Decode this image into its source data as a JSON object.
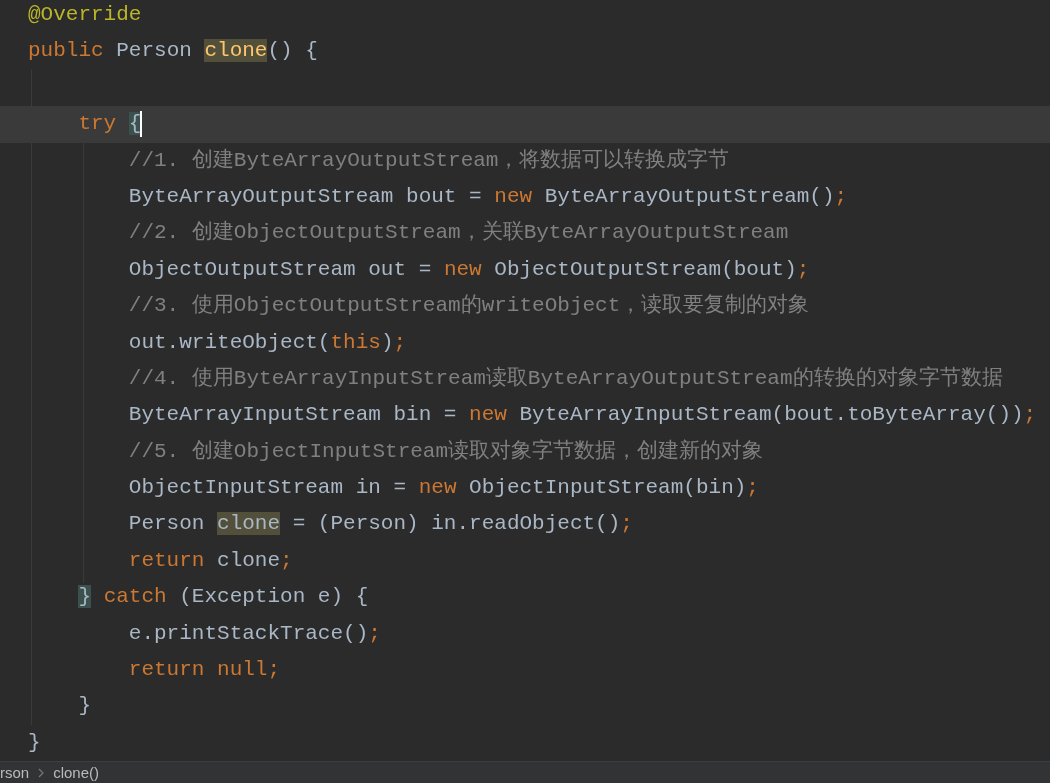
{
  "editor": {
    "lines": [
      {
        "current": false,
        "tokens": [
          {
            "kind": "annotation",
            "text": "@Override"
          }
        ]
      },
      {
        "current": false,
        "tokens": [
          {
            "kind": "keyword",
            "text": "public "
          },
          {
            "kind": "plain",
            "text": "Person "
          },
          {
            "kind": "method_usage",
            "text": "clone"
          },
          {
            "kind": "plain",
            "text": "() {"
          }
        ]
      },
      {
        "current": false
      },
      {
        "current": true,
        "caret": true,
        "tokens": [
          {
            "kind": "keyword",
            "text": "    try "
          },
          {
            "kind": "brace_match",
            "text": "{"
          }
        ]
      },
      {
        "current": false,
        "tokens": [
          {
            "kind": "comment",
            "text": "        //1. 创建ByteArrayOutputStream，将数据可以转换成字节"
          }
        ]
      },
      {
        "current": false,
        "tokens": [
          {
            "kind": "plain",
            "text": "        ByteArrayOutputStream bout = "
          },
          {
            "kind": "keyword",
            "text": "new "
          },
          {
            "kind": "plain",
            "text": "ByteArrayOutputStream()"
          },
          {
            "kind": "keyword",
            "text": ";"
          }
        ]
      },
      {
        "current": false,
        "tokens": [
          {
            "kind": "comment",
            "text": "        //2. 创建ObjectOutputStream，关联ByteArrayOutputStream"
          }
        ]
      },
      {
        "current": false,
        "tokens": [
          {
            "kind": "plain",
            "text": "        ObjectOutputStream out = "
          },
          {
            "kind": "keyword",
            "text": "new "
          },
          {
            "kind": "plain",
            "text": "ObjectOutputStream(bout)"
          },
          {
            "kind": "keyword",
            "text": ";"
          }
        ]
      },
      {
        "current": false,
        "tokens": [
          {
            "kind": "comment",
            "text": "        //3. 使用ObjectOutputStream的writeObject，读取要复制的对象"
          }
        ]
      },
      {
        "current": false,
        "tokens": [
          {
            "kind": "plain",
            "text": "        out.writeObject("
          },
          {
            "kind": "keyword",
            "text": "this"
          },
          {
            "kind": "plain",
            "text": ")"
          },
          {
            "kind": "keyword",
            "text": ";"
          }
        ]
      },
      {
        "current": false,
        "tokens": [
          {
            "kind": "comment",
            "text": "        //4. 使用ByteArrayInputStream读取ByteArrayOutputStream的转换的对象字节数据"
          }
        ]
      },
      {
        "current": false,
        "tokens": [
          {
            "kind": "plain",
            "text": "        ByteArrayInputStream bin = "
          },
          {
            "kind": "keyword",
            "text": "new "
          },
          {
            "kind": "plain",
            "text": "ByteArrayInputStream(bout.toByteArray())"
          },
          {
            "kind": "keyword",
            "text": ";"
          }
        ]
      },
      {
        "current": false,
        "tokens": [
          {
            "kind": "comment",
            "text": "        //5. 创建ObjectInputStream读取对象字节数据，创建新的对象"
          }
        ]
      },
      {
        "current": false,
        "tokens": [
          {
            "kind": "plain",
            "text": "        ObjectInputStream in = "
          },
          {
            "kind": "keyword",
            "text": "new "
          },
          {
            "kind": "plain",
            "text": "ObjectInputStream(bin)"
          },
          {
            "kind": "keyword",
            "text": ";"
          }
        ]
      },
      {
        "current": false,
        "tokens": [
          {
            "kind": "plain",
            "text": "        Person "
          },
          {
            "kind": "plain_usage",
            "text": "clone"
          },
          {
            "kind": "plain",
            "text": " = (Person) in.readObject()"
          },
          {
            "kind": "keyword",
            "text": ";"
          }
        ]
      },
      {
        "current": false,
        "tokens": [
          {
            "kind": "keyword",
            "text": "        return "
          },
          {
            "kind": "plain",
            "text": "clone"
          },
          {
            "kind": "keyword",
            "text": ";"
          }
        ]
      },
      {
        "current": false,
        "tokens": [
          {
            "kind": "brace_match",
            "text": "    }"
          },
          {
            "kind": "keyword",
            "text": " catch "
          },
          {
            "kind": "plain",
            "text": "(Exception e) {"
          }
        ]
      },
      {
        "current": false,
        "tokens": [
          {
            "kind": "plain",
            "text": "        e.printStackTrace()"
          },
          {
            "kind": "keyword",
            "text": ";"
          }
        ]
      },
      {
        "current": false,
        "tokens": [
          {
            "kind": "keyword",
            "text": "        return null;"
          }
        ]
      },
      {
        "current": false,
        "tokens": [
          {
            "kind": "plain",
            "text": "    }"
          }
        ]
      },
      {
        "current": false,
        "tokens": [
          {
            "kind": "plain",
            "text": "}"
          }
        ]
      }
    ]
  },
  "breadcrumbs": [
    "rson",
    "clone()"
  ]
}
